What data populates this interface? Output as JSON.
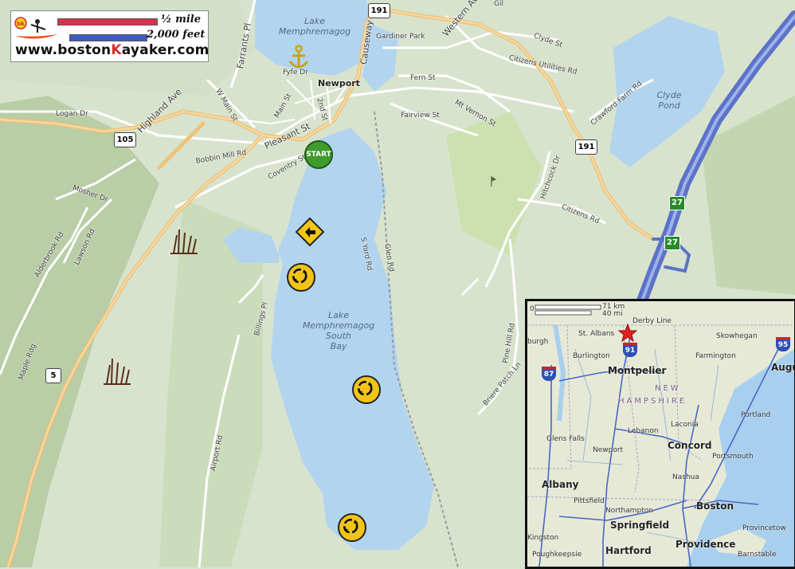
{
  "legend": {
    "scale_top": "½ mile",
    "scale_bottom": "2,000 feet",
    "site_prefix": "www.boston",
    "site_k": "K",
    "site_suffix": "ayaker.com",
    "logo_text": "bk",
    "colors": {
      "top_bar": "#d6334a",
      "bottom_bar": "#3b5cc4"
    }
  },
  "water_labels": {
    "lake_north": [
      "Lake",
      "Memphremagog"
    ],
    "lake_south": [
      "Lake",
      "Memphremagog",
      "South",
      "Bay"
    ],
    "clyde_pond": [
      "Clyde",
      "Pond"
    ]
  },
  "town": "Newport",
  "start_label": "START",
  "routes": {
    "r191a": "191",
    "r191b": "191",
    "r105": "105",
    "r5": "5",
    "i27a": "27",
    "i27b": "27"
  },
  "streets": {
    "farrants": "Farrants Pl",
    "fyfe": "Fyfe Dr",
    "w_main": "W Main St",
    "main": "Main St",
    "second": "2nd St",
    "pleasant": "Pleasant St",
    "highland": "Highland Ave",
    "logan": "Logan Dr",
    "bobbin": "Bobbin Mill Rd",
    "coventry": "Coventry St",
    "mosher": "Mosher Dr",
    "alderbrook": "Alderbrook Rd",
    "lawson": "Lawson Rd",
    "maple": "Maple Rdg",
    "billings": "Billings Pl",
    "airport": "Airport Rd",
    "causeway": "Causeway",
    "gardiner": "Gardiner Park",
    "western": "Western Ave",
    "clyde_st": "Clyde St",
    "citizens_util": "Citizens Utilities Rd",
    "fern": "Fern St",
    "fairview": "Fairview St",
    "mt_vernon": "Mt Vernon St",
    "crawford": "Crawford Farm Rd",
    "hitchcock": "Hitchcock Dr",
    "citizens_rd": "Citizens Rd",
    "s_yard": "S Yard Rd",
    "glen": "Glen Rd",
    "pine_hill": "Pine Hill Rd",
    "briere": "Briere Patch Ln",
    "gil": "Gil"
  },
  "inset": {
    "scale_km": "71 km",
    "scale_mi": "40 mi",
    "scale_zero": "0",
    "places": {
      "derby_line": "Derby Line",
      "st_albans": "St. Albans",
      "skowhegan": "Skowhegan",
      "burgh": "burgh",
      "burlington": "Burlington",
      "farmington": "Farmington",
      "montpelier": "Montpelier",
      "augusta": "Augu",
      "new": "NEW",
      "hampshire": "HAMPSHIRE",
      "portland": "Portland",
      "laconia": "Laconia",
      "lebanon": "Lebanon",
      "concord": "Concord",
      "glens_falls": "Glens Falls",
      "newport": "Newport",
      "portsmouth": "Portsmouth",
      "albany": "Albany",
      "nashua": "Nashua",
      "pittsfield": "Pittsfield",
      "boston": "Boston",
      "northampton": "Northampton",
      "springfield": "Springfield",
      "provincetown": "Provincetow",
      "kingston": "Kingston",
      "hartford": "Hartford",
      "providence": "Providence",
      "poughkeepsie": "Poughkeepsie",
      "barnstable": "Barnstable"
    },
    "shields": {
      "i91": "91",
      "i87": "87",
      "i95": "95"
    }
  }
}
